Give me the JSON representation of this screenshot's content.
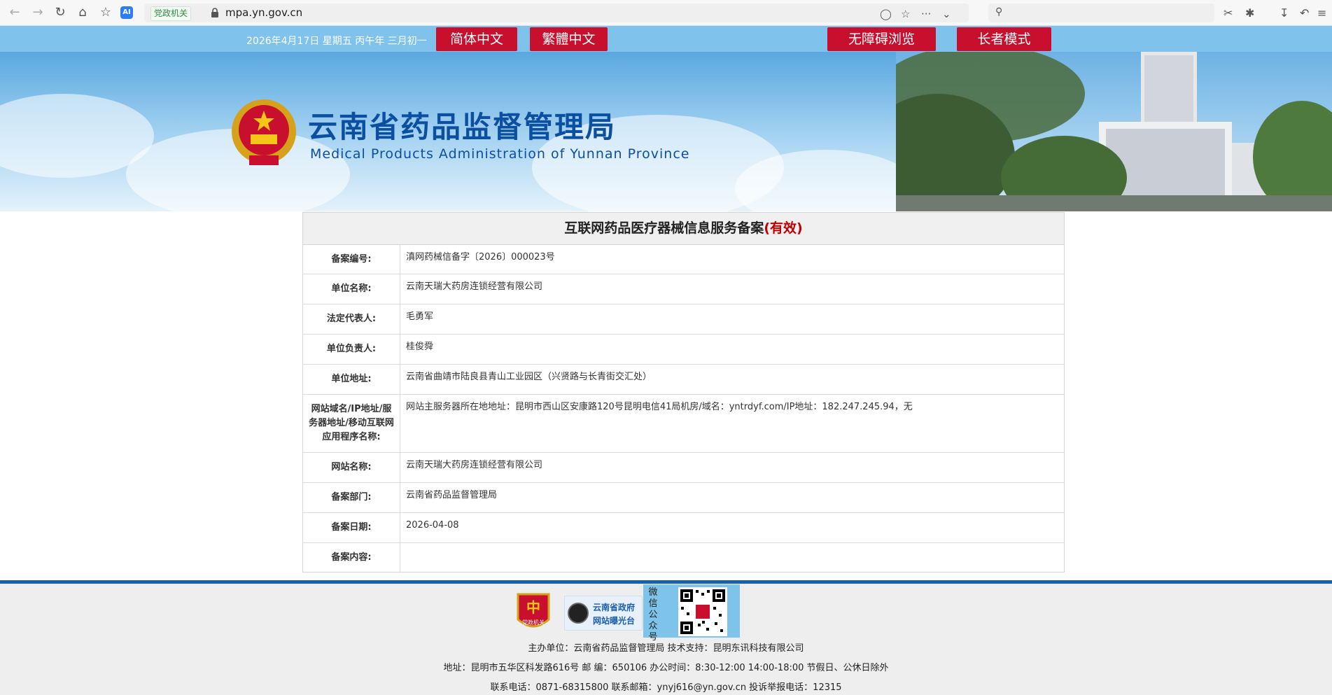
{
  "browser": {
    "badge": "党政机关",
    "url": "mpa.yn.gov.cn",
    "ai_label": "AI",
    "ellipsis": "···"
  },
  "topbar": {
    "date": "2026年4月17日 星期五 丙午年 三月初一",
    "btn_simplified": "简体中文",
    "btn_traditional": "繁體中文",
    "btn_accessible": "无障碍浏览",
    "btn_elderly": "长者模式"
  },
  "banner": {
    "title": "云南省药品监督管理局",
    "subtitle": "Medical Products Administration of Yunnan Province"
  },
  "record": {
    "heading": "互联网药品医疗器械信息服务备案",
    "status": "(有效)",
    "rows": [
      {
        "label": "备案编号:",
        "value": "滇网药械信备字〔2026〕000023号"
      },
      {
        "label": "单位名称:",
        "value": "云南天瑞大药房连锁经营有限公司"
      },
      {
        "label": "法定代表人:",
        "value": "毛勇军"
      },
      {
        "label": "单位负责人:",
        "value": "桂俊舜"
      },
      {
        "label": "单位地址:",
        "value": "云南省曲靖市陆良县青山工业园区（兴贤路与长青街交汇处）"
      },
      {
        "label": "网站域名/IP地址/服务器地址/移动互联网应用程序名称:",
        "value": "网站主服务器所在地地址：昆明市西山区安康路120号昆明电信41局机房/域名：yntrdyf.com/IP地址：182.247.245.94，无"
      },
      {
        "label": "网站名称:",
        "value": "云南天瑞大药房连锁经营有限公司"
      },
      {
        "label": "备案部门:",
        "value": "云南省药品监督管理局"
      },
      {
        "label": "备案日期:",
        "value": "2026-04-08"
      },
      {
        "label": "备案内容:",
        "value": ""
      }
    ]
  },
  "footer": {
    "badge_text": "党政机关",
    "exposure_line1": "云南省政府",
    "exposure_line2": "网站曝光台",
    "wechat_label": "微信公众号",
    "sponsor": "主办单位：云南省药品监督管理局 技术支持：昆明东讯科技有限公司",
    "address": "地址：昆明市五华区科发路616号 邮 编：650106 办公时间：8:30-12:00 14:00-18:00 节假日、公休日除外",
    "contact": "联系电话：0871-68315800 联系邮箱：ynyj616@yn.gov.cn 投诉举报电话：12315"
  },
  "colors": {
    "brand_blue": "#0b4fa0",
    "button_red": "#c8102e",
    "strip_blue": "#7fc3ec",
    "status_red": "#c00000"
  }
}
